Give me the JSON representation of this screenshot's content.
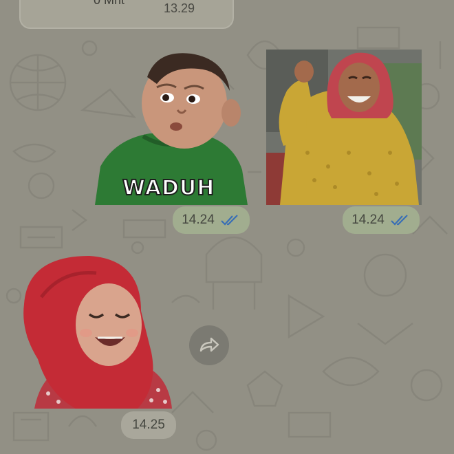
{
  "chat": {
    "top_message": {
      "duration_text": "0 Mnt",
      "time": "13.29"
    },
    "stickers": [
      {
        "name": "baby-waduh-sticker",
        "caption": "WADUH",
        "time": "14.24",
        "status": "read"
      },
      {
        "name": "laughing-woman-sticker",
        "time": "14.24",
        "status": "read"
      },
      {
        "name": "laughing-baby-hijab-sticker",
        "time": "14.25"
      }
    ],
    "forward_icon": "forward-arrow-icon"
  },
  "colors": {
    "wallpaper": "#9c9a8e",
    "outgoing_meta": "#a1ad8f",
    "incoming_meta": "#a9a79b",
    "read_ticks": "#3a6fb5"
  }
}
